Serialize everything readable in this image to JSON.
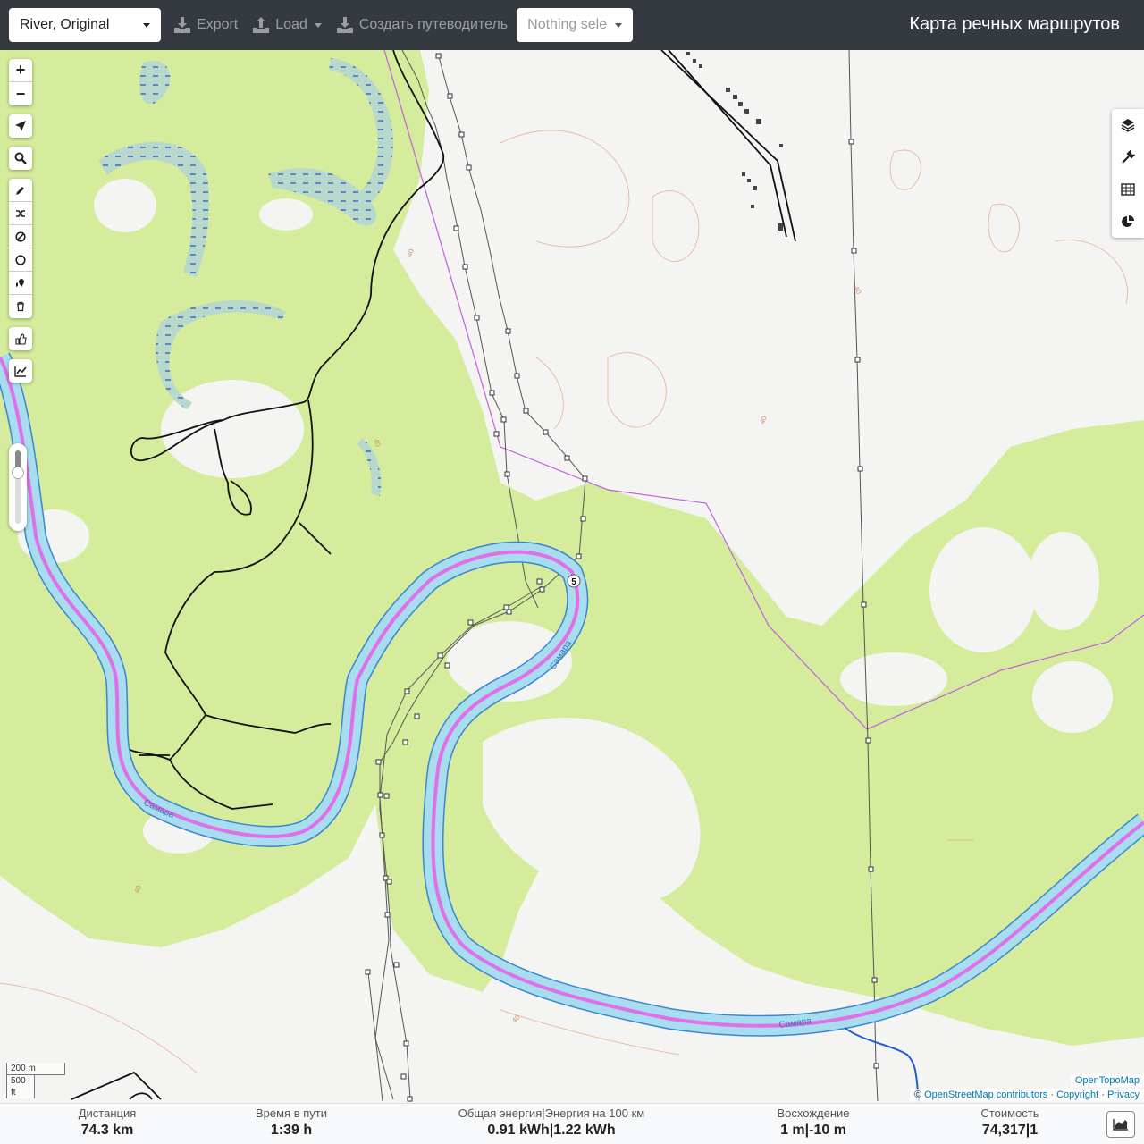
{
  "navbar": {
    "profile_select": "River, Original",
    "export_label": "Export",
    "load_label": "Load",
    "guide_label": "Создать путеводитель",
    "selection_placeholder": "Nothing sele",
    "brand": "Карта речных маршрутов"
  },
  "map": {
    "river_name_1": "Самара",
    "river_name_2": "Самара",
    "river_name_3": "Самара",
    "waypoint": "5",
    "contour_labels": [
      "40",
      "40",
      "40",
      "40",
      "40",
      "40"
    ],
    "scale_metric": "200 m",
    "scale_imperial": "500 ft",
    "attribution_layer": "OpenTopoMap",
    "attribution_osm": "OpenStreetMap contributors",
    "attribution_copyright": "Copyright",
    "attribution_privacy": "Privacy",
    "attribution_prefix": "©",
    "attribution_sep": "·"
  },
  "left_controls": {
    "zoom_in": "+",
    "zoom_out": "−"
  },
  "stats": {
    "distance_label": "Дистанция",
    "distance_value": "74.3 km",
    "time_label": "Время в пути",
    "time_value": "1:39 h",
    "energy_label": "Общая энергия|Энергия на 100 км",
    "energy_value": "0.91 kWh|1.22 kWh",
    "ascent_label": "Восхождение",
    "ascent_value": "1 m|-10 m",
    "cost_label": "Стоимость",
    "cost_value": "74,317|1"
  },
  "colors": {
    "forest": "#d4ec9c",
    "river_fill": "#a8dcef",
    "river_edge": "#3b85d0",
    "route": "#e070e8",
    "boundary": "#c060e0",
    "navbar": "#343a40"
  }
}
